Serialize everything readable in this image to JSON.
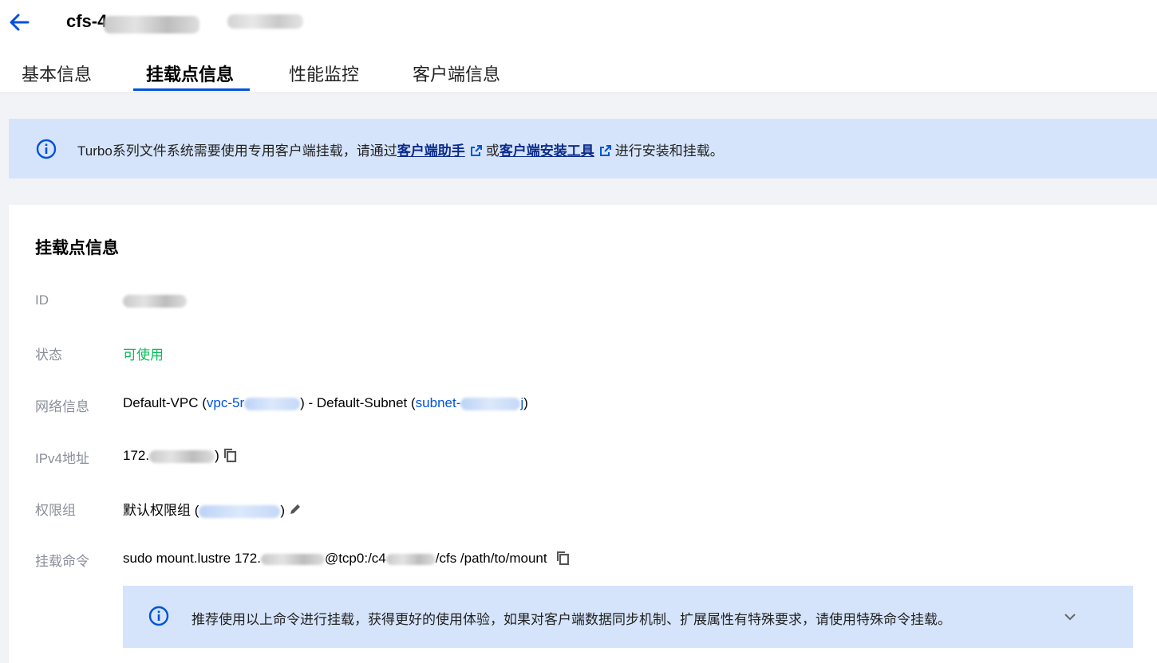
{
  "header": {
    "title_prefix": "cfs-4"
  },
  "tabs": [
    {
      "label": "基本信息"
    },
    {
      "label": "挂载点信息"
    },
    {
      "label": "性能监控"
    },
    {
      "label": "客户端信息"
    }
  ],
  "notice": {
    "text_before": "Turbo系列文件系统需要使用专用客户端挂载，请通过",
    "link1": "客户端助手",
    "text_mid": "或",
    "link2": "客户端安装工具",
    "text_after": "进行安装和挂载。"
  },
  "card": {
    "title": "挂载点信息",
    "rows": {
      "id": {
        "label": "ID"
      },
      "status": {
        "label": "状态",
        "value": "可使用"
      },
      "network": {
        "label": "网络信息",
        "vpc_prefix": "Default-VPC (",
        "vpc_id": "vpc-5r",
        "vpc_suffix": ") - Default-Subnet (",
        "subnet_id": "subnet-",
        "subnet_tail": "j",
        "subnet_suffix": ")"
      },
      "ipv4": {
        "label": "IPv4地址",
        "value_prefix": "172.",
        "value_suffix": ")"
      },
      "permission": {
        "label": "权限组",
        "value_prefix": "默认权限组 (",
        "value_suffix": ")"
      },
      "mount_cmd": {
        "label": "挂载命令",
        "part1": "sudo mount.lustre 172.",
        "part2": "@tcp0:/c4",
        "part3": "/cfs /path/to/mount"
      }
    },
    "tip": "推荐使用以上命令进行挂载，获得更好的使用体验，如果对客户端数据同步机制、扩展属性有特殊要求，请使用特殊命令挂载。"
  },
  "colors": {
    "accent": "#0052d9",
    "success": "#0abf5b",
    "notice_bg": "#d5e4fb"
  }
}
